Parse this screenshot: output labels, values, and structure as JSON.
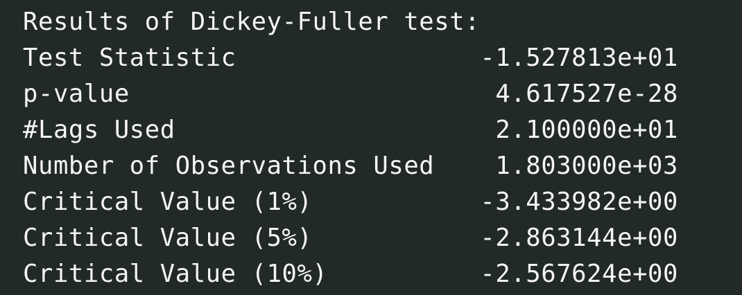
{
  "output": {
    "header": "Results of Dickey-Fuller test:",
    "rows": [
      {
        "label": "Test Statistic",
        "value": "-1.527813e+01"
      },
      {
        "label": "p-value",
        "value": "4.617527e-28"
      },
      {
        "label": "#Lags Used",
        "value": "2.100000e+01"
      },
      {
        "label": "Number of Observations Used",
        "value": "1.803000e+03"
      },
      {
        "label": "Critical Value (1%)",
        "value": "-3.433982e+00"
      },
      {
        "label": "Critical Value (5%)",
        "value": "-2.863144e+00"
      },
      {
        "label": "Critical Value (10%)",
        "value": "-2.567624e+00"
      }
    ]
  },
  "colors": {
    "background": "#222a28",
    "text": "#f5f5f5"
  }
}
